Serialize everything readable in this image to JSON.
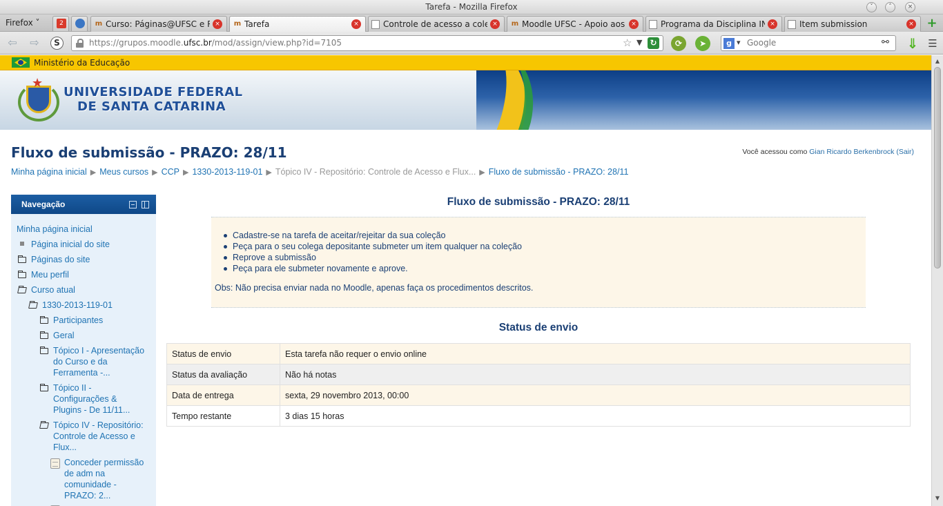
{
  "window": {
    "title": "Tarefa - Mozilla Firefox"
  },
  "browser": {
    "menu_label": "Firefox",
    "tabs": [
      {
        "label": "Curso: Páginas@UFSC e R..."
      },
      {
        "label": "Tarefa"
      },
      {
        "label": "Controle de acesso a cole..."
      },
      {
        "label": "Moodle UFSC - Apoio aos ..."
      },
      {
        "label": "Programa da Disciplina IN..."
      },
      {
        "label": "Item submission"
      }
    ],
    "pinned": [
      {
        "name": "gmail-pinned-tab",
        "text": "2"
      },
      {
        "name": "pinned-tab-2",
        "text": ""
      }
    ],
    "url_prefix": "https://grupos.moodle.",
    "url_domain": "ufsc.br",
    "url_suffix": "/mod/assign/view.php?id=7105",
    "search_placeholder": "Google"
  },
  "gov_bar": {
    "label": "Ministério da Educação"
  },
  "banner": {
    "line1": "UNIVERSIDADE FEDERAL",
    "line2": "DE SANTA CATARINA"
  },
  "header": {
    "page_title": "Fluxo de submissão - PRAZO: 28/11",
    "login_prefix": "Você acessou como ",
    "login_user": "Gian Ricardo Berkenbrock",
    "login_logout": "(Sair)"
  },
  "breadcrumb": [
    {
      "label": "Minha página inicial",
      "link": true
    },
    {
      "label": "Meus cursos",
      "link": true
    },
    {
      "label": "CCP",
      "link": true
    },
    {
      "label": "1330-2013-119-01",
      "link": true
    },
    {
      "label": "Tópico IV - Repositório: Controle de Acesso e Flux...",
      "link": false
    },
    {
      "label": "Fluxo de submissão - PRAZO: 28/11",
      "link": true
    }
  ],
  "navigation": {
    "title": "Navegação",
    "home": "Minha página inicial",
    "site_home": "Página inicial do site",
    "site_pages": "Páginas do site",
    "my_profile": "Meu perfil",
    "current_course": "Curso atual",
    "course_code": "1330-2013-119-01",
    "participants": "Participantes",
    "general": "Geral",
    "topic1_l1": "Tópico I - Apresentação",
    "topic1_l2": "do Curso e da",
    "topic1_l3": "Ferramenta -...",
    "topic2_l1": "Tópico II -",
    "topic2_l2": "Configurações &",
    "topic2_l3": "Plugins - De 11/11...",
    "topic4_l1": "Tópico IV - Repositório:",
    "topic4_l2": "Controle de Acesso e",
    "topic4_l3": "Flux...",
    "activity_l1": "Conceder permissão",
    "activity_l2": "de adm na",
    "activity_l3": "comunidade -",
    "activity_l4": "PRAZO: 2..."
  },
  "assignment": {
    "title": "Fluxo de submissão - PRAZO: 28/11",
    "steps": [
      "Cadastre-se na tarefa de aceitar/rejeitar da sua coleção",
      "Peça para o seu colega depositante submeter um item qualquer na coleção",
      "Reprove a submissão",
      "Peça para ele submeter novamente e aprove."
    ],
    "obs": "Obs: Não precisa enviar nada no Moodle, apenas faça os procedimentos descritos."
  },
  "submission_status": {
    "heading": "Status de envio",
    "rows": [
      {
        "label": "Status de envio",
        "value": "Esta tarefa não requer o envio online"
      },
      {
        "label": "Status da avaliação",
        "value": "Não há notas"
      },
      {
        "label": "Data de entrega",
        "value": "sexta, 29 novembro 2013, 00:00"
      },
      {
        "label": "Tempo restante",
        "value": "3 dias 15 horas"
      }
    ]
  }
}
